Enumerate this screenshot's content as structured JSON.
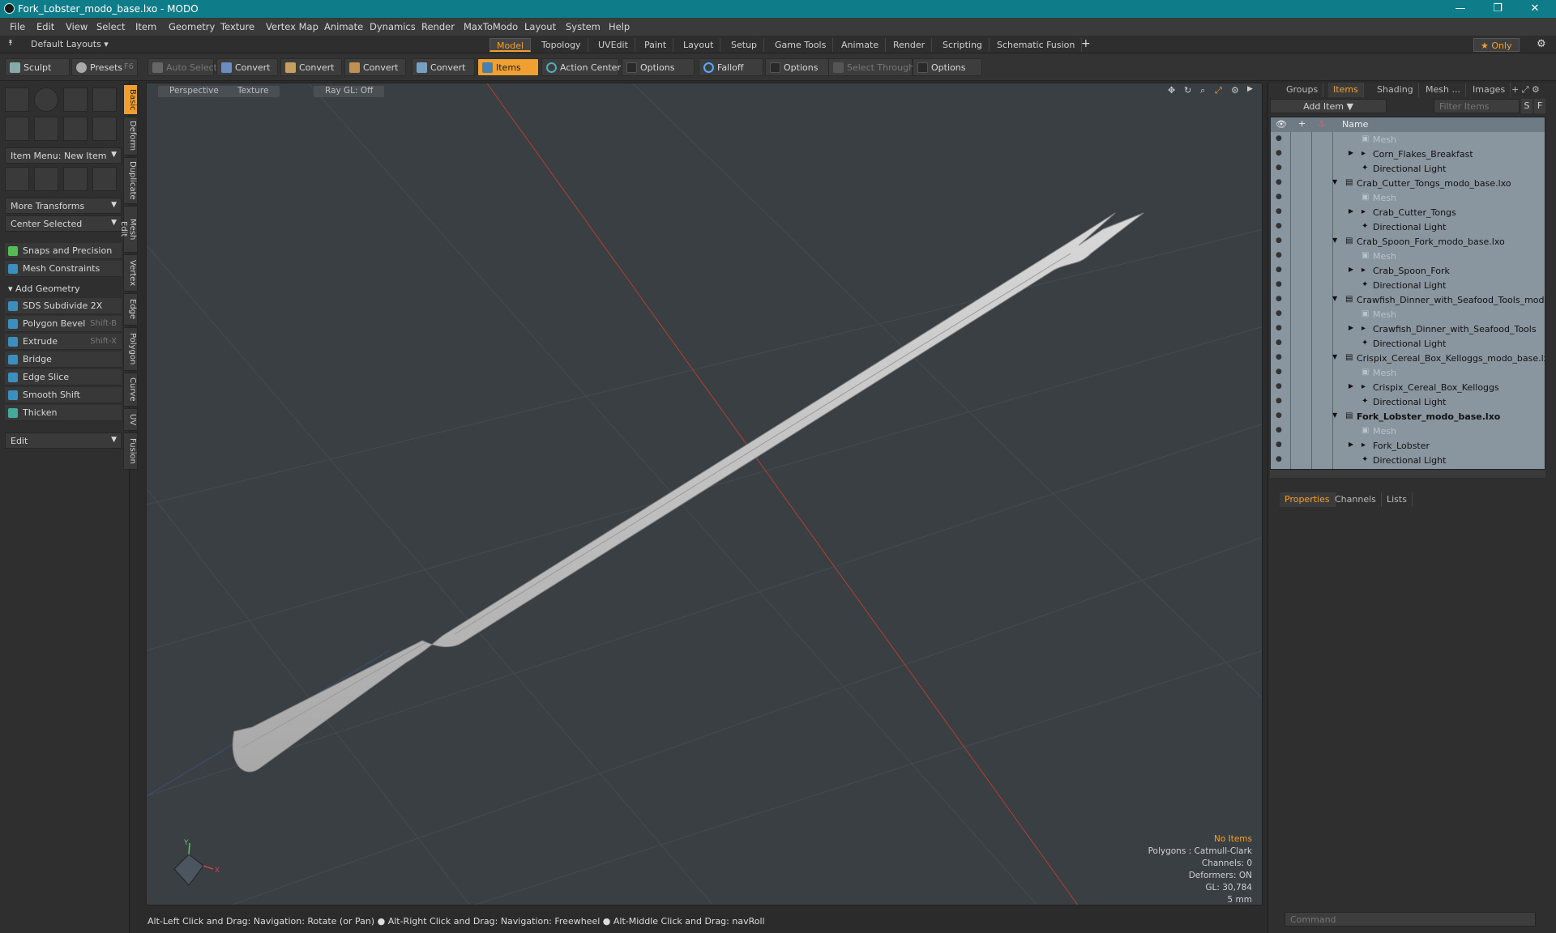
{
  "window": {
    "title": "Fork_Lobster_modo_base.lxo - MODO",
    "minimize": "—",
    "maximize": "❐",
    "close": "✕"
  },
  "menu": [
    "File",
    "Edit",
    "View",
    "Select",
    "Item",
    "Geometry",
    "Texture",
    "Vertex Map",
    "Animate",
    "Dynamics",
    "Render",
    "MaxToModo",
    "Layout",
    "System",
    "Help"
  ],
  "layout_bar": {
    "layouts_label": "Default Layouts ▾",
    "tabs": [
      "Model",
      "Topology",
      "UVEdit",
      "Paint",
      "Layout",
      "Setup",
      "Game Tools",
      "Animate",
      "Render",
      "Scripting",
      "Schematic Fusion"
    ],
    "active_tab": "Model",
    "add": "+",
    "only_label": "★  Only",
    "gear": "⚙"
  },
  "toolbar": {
    "sculpt": "Sculpt",
    "presets": "Presets",
    "presets_shortcut": "F6",
    "auto_select": "Auto Select",
    "convert1": "Convert",
    "convert2": "Convert",
    "convert3": "Convert",
    "convert4": "Convert",
    "items": "Items",
    "action_center": "Action Center",
    "options1": "Options",
    "falloff": "Falloff",
    "options2": "Options",
    "select_through": "Select Through",
    "options3": "Options"
  },
  "left_panel": {
    "item_menu": "Item Menu: New Item",
    "more_transforms": "More Transforms",
    "center_selected": "Center Selected",
    "snaps": "Snaps and Precision",
    "mesh_constraints": "Mesh Constraints",
    "add_geometry": "Add Geometry",
    "tools": [
      {
        "label": "SDS Subdivide 2X",
        "shortcut": ""
      },
      {
        "label": "Polygon Bevel",
        "shortcut": "Shift-B"
      },
      {
        "label": "Extrude",
        "shortcut": "Shift-X"
      },
      {
        "label": "Bridge",
        "shortcut": ""
      },
      {
        "label": "Edge Slice",
        "shortcut": ""
      },
      {
        "label": "Smooth Shift",
        "shortcut": ""
      },
      {
        "label": "Thicken",
        "shortcut": ""
      }
    ],
    "edit": "Edit",
    "side_tabs": [
      "Basic",
      "Deform",
      "Duplicate",
      "Mesh Edit",
      "Vertex",
      "Edge",
      "Polygon",
      "Curve",
      "UV",
      "Fusion"
    ]
  },
  "viewport": {
    "perspective": "Perspective",
    "texture": "Texture",
    "raygl": "Ray GL: Off",
    "info": {
      "no_items": "No Items",
      "polygons": "Polygons : Catmull-Clark",
      "channels": "Channels: 0",
      "deformers": "Deformers: ON",
      "gl": "GL: 30,784",
      "unit": "5 mm"
    },
    "axis_y": "Y",
    "axis_x": "X"
  },
  "status": "Alt-Left Click and Drag: Navigation: Rotate (or Pan) ●  Alt-Right Click and Drag: Navigation: Freewheel ●  Alt-Middle Click and Drag: navRoll",
  "right_panel": {
    "tabs": [
      "Groups",
      "Items",
      "Shading",
      "Mesh ...",
      "Images"
    ],
    "active_tab": "Items",
    "add_item": "Add Item",
    "filter": "Filter Items",
    "s_btn": "S",
    "f_btn": "F",
    "name_col": "Name",
    "rows": [
      {
        "label": "Mesh",
        "type": "mesh",
        "indent": 2,
        "dim": true
      },
      {
        "label": "Corn_Flakes_Breakfast",
        "type": "group",
        "indent": 2
      },
      {
        "label": "Directional Light",
        "type": "light",
        "indent": 2
      },
      {
        "label": "Crab_Cutter_Tongs_modo_base.lxo",
        "type": "scene",
        "indent": 1
      },
      {
        "label": "Mesh",
        "type": "mesh",
        "indent": 2,
        "dim": true
      },
      {
        "label": "Crab_Cutter_Tongs",
        "type": "group",
        "indent": 2
      },
      {
        "label": "Directional Light",
        "type": "light",
        "indent": 2
      },
      {
        "label": "Crab_Spoon_Fork_modo_base.lxo",
        "type": "scene",
        "indent": 1
      },
      {
        "label": "Mesh",
        "type": "mesh",
        "indent": 2,
        "dim": true
      },
      {
        "label": "Crab_Spoon_Fork",
        "type": "group",
        "indent": 2
      },
      {
        "label": "Directional Light",
        "type": "light",
        "indent": 2
      },
      {
        "label": "Crawfish_Dinner_with_Seafood_Tools_mod...",
        "type": "scene",
        "indent": 1
      },
      {
        "label": "Mesh",
        "type": "mesh",
        "indent": 2,
        "dim": true
      },
      {
        "label": "Crawfish_Dinner_with_Seafood_Tools",
        "type": "group",
        "indent": 2
      },
      {
        "label": "Directional Light",
        "type": "light",
        "indent": 2
      },
      {
        "label": "Crispix_Cereal_Box_Kelloggs_modo_base.lxo",
        "type": "scene",
        "indent": 1
      },
      {
        "label": "Mesh",
        "type": "mesh",
        "indent": 2,
        "dim": true
      },
      {
        "label": "Crispix_Cereal_Box_Kelloggs",
        "type": "group",
        "indent": 2
      },
      {
        "label": "Directional Light",
        "type": "light",
        "indent": 2
      },
      {
        "label": "Fork_Lobster_modo_base.lxo",
        "type": "scene",
        "indent": 1,
        "bold": true
      },
      {
        "label": "Mesh",
        "type": "mesh",
        "indent": 2,
        "dim": true
      },
      {
        "label": "Fork_Lobster",
        "type": "group",
        "indent": 2
      },
      {
        "label": "Directional Light",
        "type": "light",
        "indent": 2
      }
    ],
    "bottom_tabs": [
      "Properties",
      "Channels",
      "Lists"
    ],
    "bottom_active": "Properties",
    "command_placeholder": "Command"
  },
  "colors": {
    "accent": "#f0a030",
    "titlebar": "#0f7d89",
    "list_bg": "#8996a0"
  }
}
